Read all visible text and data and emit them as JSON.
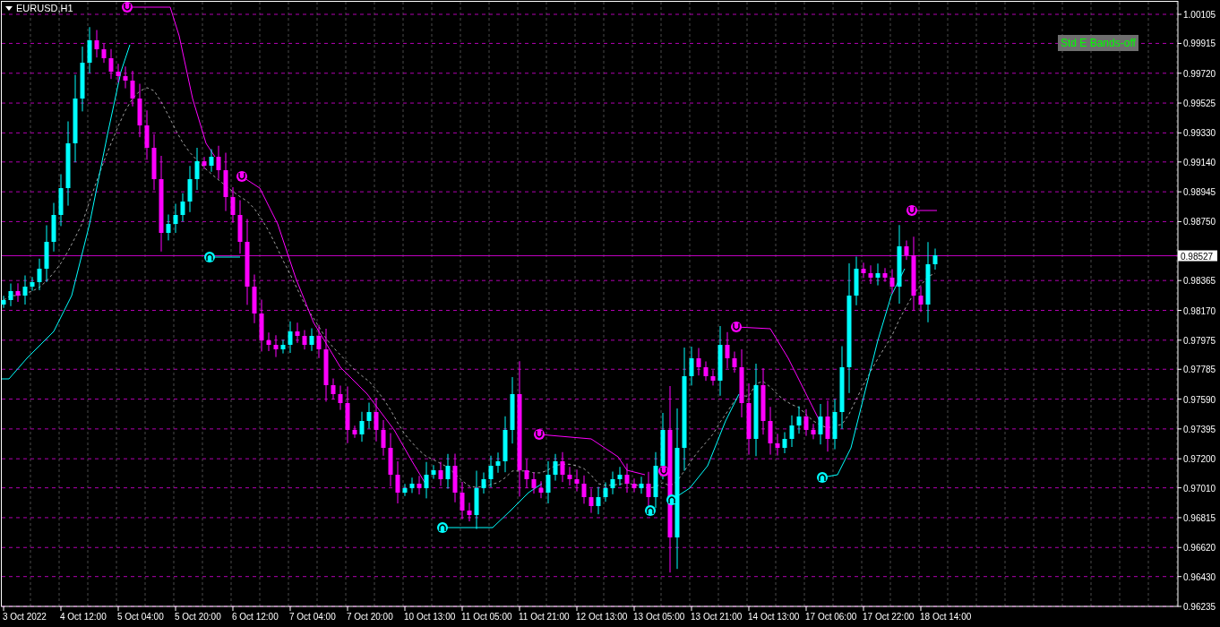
{
  "chart": {
    "symbol": "EURUSD,H1",
    "indicator_button": "Std E Bands-off",
    "current_price": "0.98527",
    "price_axis": [
      "1.00105",
      "0.99915",
      "0.99720",
      "0.99525",
      "0.99330",
      "0.99140",
      "0.98945",
      "0.98750",
      "0.98365",
      "0.98170",
      "0.97975",
      "0.97785",
      "0.97590",
      "0.97395",
      "0.97200",
      "0.97010",
      "0.96815",
      "0.96620",
      "0.96430",
      "0.96235"
    ],
    "time_axis": [
      "3 Oct 2022",
      "4 Oct 12:00",
      "5 Oct 04:00",
      "5 Oct 20:00",
      "6 Oct 12:00",
      "7 Oct 04:00",
      "7 Oct 20:00",
      "10 Oct 13:00",
      "11 Oct 05:00",
      "11 Oct 21:00",
      "12 Oct 13:00",
      "13 Oct 05:00",
      "13 Oct 21:00",
      "14 Oct 13:00",
      "17 Oct 06:00",
      "17 Oct 22:00",
      "18 Oct 14:00"
    ]
  }
}
